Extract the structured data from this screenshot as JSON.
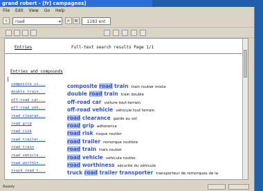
{
  "window_title": "grand robert - [fr] campagnes]",
  "menu": [
    "File",
    "Edit",
    "View",
    "Go",
    "Help"
  ],
  "toolbar": {
    "search_value": "road",
    "result_count": "1183 ent"
  },
  "header": {
    "entries_label": "Entries",
    "results_label": "Full-text search results  Page 1/1"
  },
  "section_title": "Entries and compounds",
  "results": [
    {
      "entry": "composite ci...",
      "pre": "composite ",
      "hl": "road",
      "post": " train",
      "trans": "train routier mixte"
    },
    {
      "entry": "double train...",
      "pre": "double ",
      "hl": "road",
      "post": " train",
      "trans": "train double"
    },
    {
      "entry": "off-road car...",
      "pre": "off-road car",
      "hl": "",
      "post": "",
      "trans": "voiture tout-terrain"
    },
    {
      "entry": "off-road veh...",
      "pre": "off-road vehicle",
      "hl": "",
      "post": "",
      "trans": "véhicule tout terrain"
    },
    {
      "entry": "road clearan...",
      "pre": "",
      "hl": "road",
      "post": " clearance",
      "trans": "garde au sol"
    },
    {
      "entry": "road grip",
      "pre": "",
      "hl": "road",
      "post": " grip",
      "trans": "adhérence"
    },
    {
      "entry": "road risk",
      "pre": "",
      "hl": "road",
      "post": " risk",
      "trans": "risque routier"
    },
    {
      "entry": "road trailer...",
      "pre": "",
      "hl": "road",
      "post": " trailer",
      "trans": "remorque routière"
    },
    {
      "entry": "road train",
      "pre": "",
      "hl": "road",
      "post": " train",
      "trans": "train routier"
    },
    {
      "entry": "road vehicle...",
      "pre": "",
      "hl": "road",
      "post": " vehicle",
      "trans": "véhicule routier"
    },
    {
      "entry": "road worthin...",
      "pre": "",
      "hl": "road",
      "post": " worthiness",
      "trans": "sécurité du véhicule"
    },
    {
      "entry": "truck road t...",
      "pre": "truck ",
      "hl": "road",
      "post": " trailer transporter",
      "trans": "transporteur de remorques de la"
    }
  ],
  "status": {
    "text": "Ready"
  }
}
